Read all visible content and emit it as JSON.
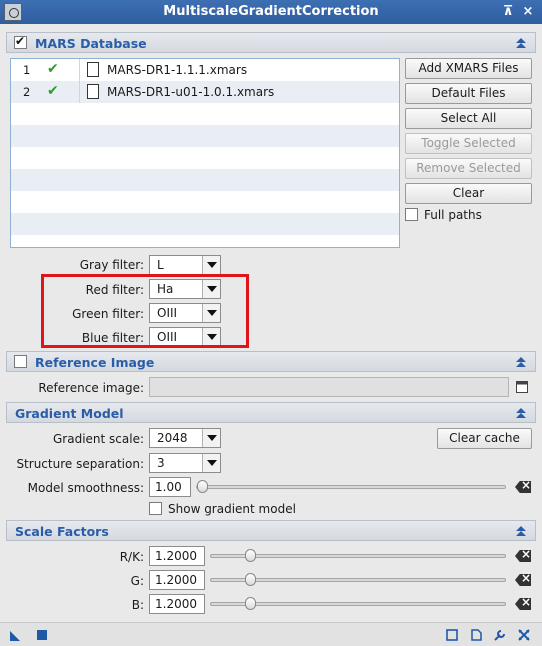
{
  "window": {
    "title": "MultiscaleGradientCorrection"
  },
  "mars_database": {
    "title": "MARS Database",
    "files": [
      {
        "index": "1",
        "name": "MARS-DR1-1.1.1.xmars"
      },
      {
        "index": "2",
        "name": "MARS-DR1-u01-1.0.1.xmars"
      }
    ],
    "buttons": {
      "add": "Add XMARS Files",
      "default": "Default Files",
      "select_all": "Select All",
      "toggle": "Toggle Selected",
      "remove": "Remove Selected",
      "clear": "Clear"
    },
    "full_paths_label": "Full paths",
    "filters": {
      "gray_label": "Gray filter:",
      "gray_value": "L",
      "red_label": "Red filter:",
      "red_value": "Ha",
      "green_label": "Green filter:",
      "green_value": "OIII",
      "blue_label": "Blue filter:",
      "blue_value": "OIII"
    }
  },
  "reference_image": {
    "title": "Reference Image",
    "label": "Reference image:",
    "value": ""
  },
  "gradient_model": {
    "title": "Gradient Model",
    "scale_label": "Gradient scale:",
    "scale_value": "2048",
    "clear_cache": "Clear cache",
    "separation_label": "Structure separation:",
    "separation_value": "3",
    "smoothness_label": "Model smoothness:",
    "smoothness_value": "1.00",
    "smoothness_fraction": 0.0,
    "show_model_label": "Show gradient model"
  },
  "scale_factors": {
    "title": "Scale Factors",
    "items": [
      {
        "label": "R/K:",
        "value": "1.2000",
        "fraction": 0.12
      },
      {
        "label": "G:",
        "value": "1.2000",
        "fraction": 0.12
      },
      {
        "label": "B:",
        "value": "1.2000",
        "fraction": 0.12
      }
    ]
  },
  "colors": {
    "title_bar": "#2f5e9f",
    "section_label": "#2a5da8",
    "highlight": "#e0151b",
    "check_ok": "#2e9b2e"
  },
  "icons": {
    "collapse": "chevron-up-icon",
    "file": "document-icon",
    "reset": "reset-icon"
  }
}
